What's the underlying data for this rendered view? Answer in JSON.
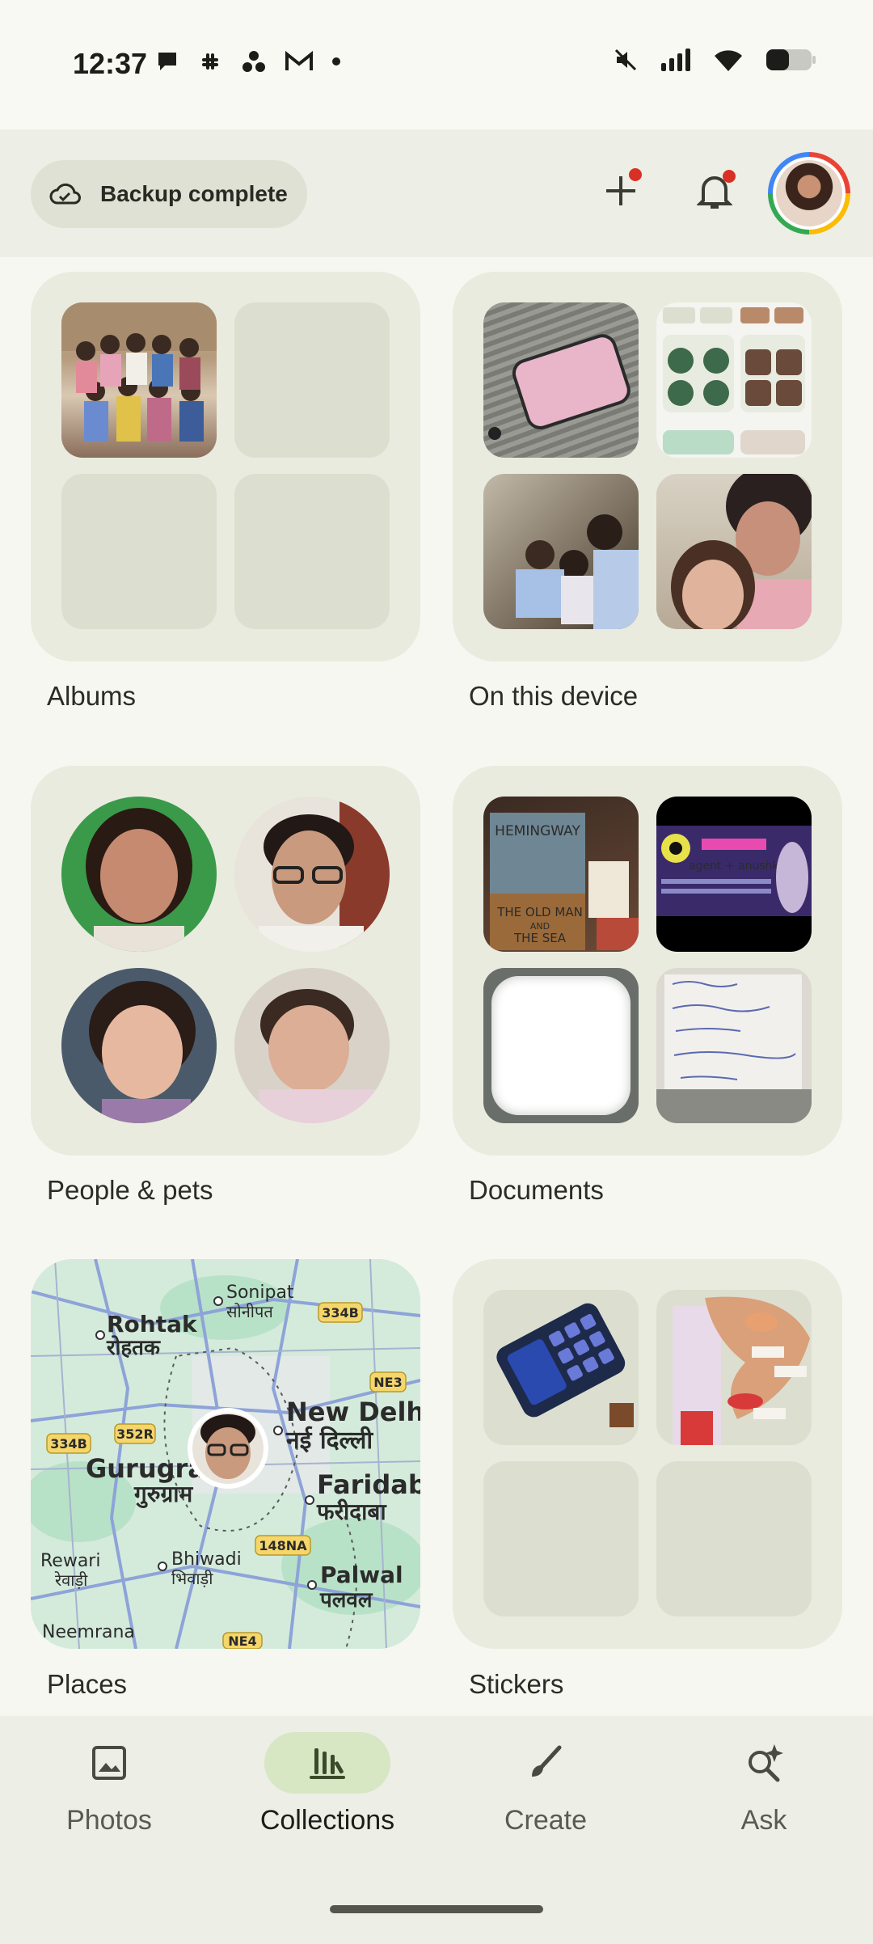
{
  "status_bar": {
    "time": "12:37"
  },
  "header": {
    "backup_label": "Backup complete"
  },
  "collections": [
    {
      "label": "Albums"
    },
    {
      "label": "On this device"
    },
    {
      "label": "People & pets"
    },
    {
      "label": "Documents"
    },
    {
      "label": "Places"
    },
    {
      "label": "Stickers"
    }
  ],
  "map": {
    "places": [
      {
        "name": "Sonipat",
        "local": "सोनीपत"
      },
      {
        "name": "Rohtak",
        "local": "रोहतक"
      },
      {
        "name": "New Delhi",
        "local": "नई दिल्ली"
      },
      {
        "name": "Gurugra",
        "local": "गुरुग्राम"
      },
      {
        "name": "Faridaba",
        "local": "फरीदाबा"
      },
      {
        "name": "Bhiwadi",
        "local": "भिवाड़ी"
      },
      {
        "name": "Rewari",
        "local": "रेवाड़ी"
      },
      {
        "name": "Palwal",
        "local": "पलवल"
      },
      {
        "name": "Neemrana",
        "local": ""
      }
    ],
    "roads": [
      "334B",
      "NE3",
      "352R",
      "334B",
      "148NA",
      "NE4"
    ]
  },
  "document_thumb": {
    "book_title_1": "HEMINGWAY",
    "book_title_2": "THE OLD MAN",
    "book_title_3": "AND",
    "book_title_4": "THE SEA",
    "poster_text": "agent + anushka"
  },
  "bottom_nav": [
    {
      "label": "Photos"
    },
    {
      "label": "Collections"
    },
    {
      "label": "Create"
    },
    {
      "label": "Ask"
    }
  ],
  "colors": {
    "accent_active": "#d7e6c3",
    "notification_dot": "#d93025",
    "tile_bg": "#e9ebde"
  }
}
